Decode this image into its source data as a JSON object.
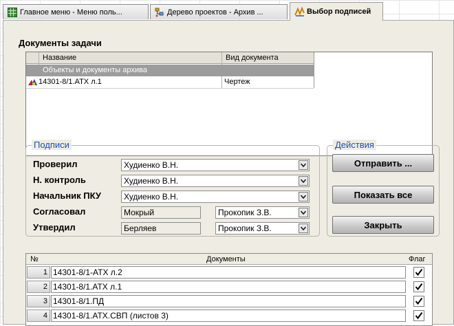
{
  "tabs": [
    {
      "label": "Главное меню - Меню поль...",
      "icon": "grid-menu-icon",
      "active": false
    },
    {
      "label": "Дерево проектов - Архив ...",
      "icon": "project-tree-icon",
      "active": false
    },
    {
      "label": "Выбор подписей",
      "icon": "signature-select-icon",
      "active": true
    }
  ],
  "documents_section": {
    "title": "Документы задачи",
    "columns": [
      "Название",
      "Вид документа"
    ],
    "rows": [
      {
        "name": "Объекты и документы архива",
        "type": "",
        "selected": true
      },
      {
        "name": "14301-8/1.АТХ л.1",
        "type": "Чертеж",
        "icon": "drawing-doc-icon"
      }
    ]
  },
  "signatures": {
    "title": "Подписи",
    "rows": [
      {
        "label": "Проверил",
        "value": "Худиенко В.Н."
      },
      {
        "label": "Н. контроль",
        "value": "Худиенко В.Н."
      },
      {
        "label": "Начальник ПКУ",
        "value": "Худиенко В.Н."
      },
      {
        "label": "Согласовал",
        "text": "Мокрый",
        "value": "Прокопик З.В."
      },
      {
        "label": "Утвердил",
        "text": "Берляев",
        "value": "Прокопик З.В."
      }
    ]
  },
  "actions": {
    "title": "Действия",
    "send": "Отправить ...",
    "show_all": "Показать все",
    "close": "Закрыть"
  },
  "doc_list": {
    "columns": {
      "num": "№",
      "docs": "Документы",
      "flag": "Флаг"
    },
    "rows": [
      {
        "num": "1",
        "name": "14301-8/1-АТХ л.2",
        "flag": true
      },
      {
        "num": "2",
        "name": "14301-8/1.АТХ л.1",
        "flag": true
      },
      {
        "num": "3",
        "name": "14301-8/1.ПД",
        "flag": true
      },
      {
        "num": "4",
        "name": "14301-8/1.АТХ.СВП (листов 3)",
        "flag": true
      }
    ]
  },
  "colors": {
    "panel_bg": "#efede3",
    "group_title": "#1c4fb0",
    "selected_row": "#9c9c9c"
  }
}
